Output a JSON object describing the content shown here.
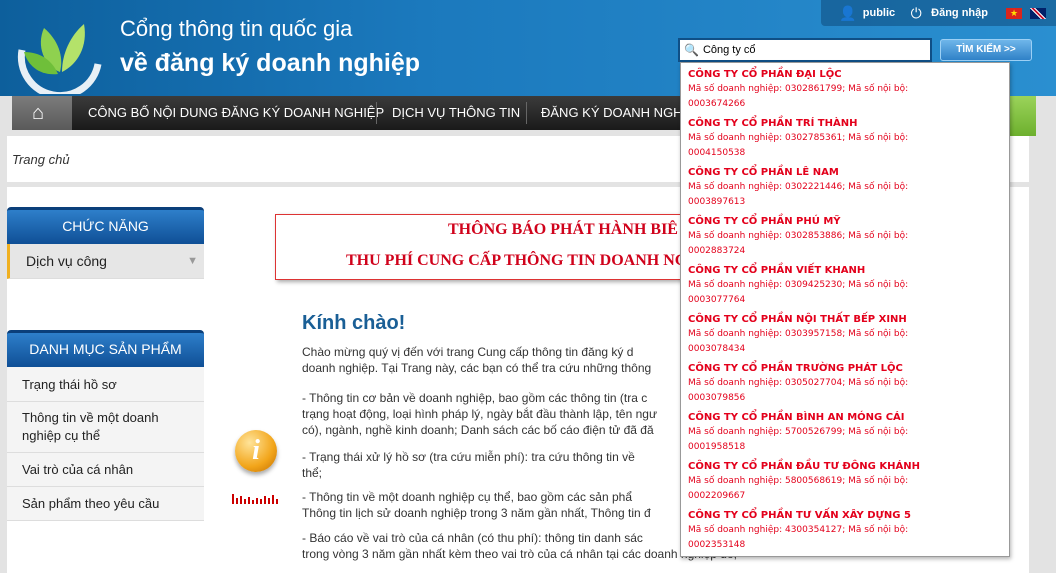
{
  "header": {
    "title_line1": "Cổng thông tin quốc gia",
    "title_line2": "về đăng ký doanh nghiệp",
    "user_label": "public",
    "login_label": "Đăng nhập",
    "search_value": "Công ty cổ",
    "search_button": "TÌM KIẾM >>"
  },
  "nav": {
    "items": [
      "CÔNG BỐ NỘI DUNG ĐĂNG KÝ DOANH NGHIỆP",
      "DỊCH VỤ THÔNG TIN",
      "ĐĂNG KÝ DOANH NGHIỆ"
    ]
  },
  "breadcrumb": "Trang chủ",
  "sidebar": {
    "functions_title": "CHỨC NĂNG",
    "functions_item": "Dịch vụ công",
    "products_title": "DANH MỤC SẢN PHẨM",
    "products": [
      "Trạng thái hồ sơ",
      "Thông tin về một doanh",
      "nghiệp cụ thể",
      "Vai trò của cá nhân",
      "Sản phẩm theo yêu cầu"
    ]
  },
  "notice": {
    "line1": "THÔNG BÁO PHÁT HÀNH BIÊ",
    "line2": "THU PHÍ CUNG CẤP THÔNG TIN DOANH NG"
  },
  "main": {
    "greeting": "Kính chào!",
    "lines": [
      "Chào mừng quý vị đến với trang Cung cấp thông tin đăng ký d",
      "doanh nghiệp. Tại Trang này, các bạn có thể tra cứu những thông",
      "- Thông tin cơ bản về doanh nghiệp, bao gồm các thông tin (tra c",
      "trạng hoạt động, loại hình pháp lý, ngày bắt đầu thành lập, tên ngư",
      "có), ngành, nghề kinh doanh; Danh sách các bố cáo điện tử đã đă",
      "- Trạng thái xử lý hồ sơ (tra cứu miễn phí): tra cứu thông tin về",
      "thể;",
      "- Thông tin về một doanh nghiệp cụ thể, bao gồm các sản phẩ",
      "Thông tin lịch sử doanh nghiệp trong 3 năm gần nhất, Thông tin đ",
      "- Báo cáo về vai trò của cá nhân (có thu phí): thông tin danh sác",
      "trong vòng 3 năm gần nhất kèm theo vai trò của cá nhân tại các doanh nghiệp đó;"
    ]
  },
  "dropdown": {
    "code_prefix": "Mã số doanh nghiệp: ",
    "internal_prefix": "; Mã số nội bộ:",
    "items": [
      {
        "name": "CÔNG TY CỔ PHẦN ĐẠI LỘC",
        "code": "0302861799",
        "internal": "0003674266"
      },
      {
        "name": "CÔNG TY CỔ PHẦN TRÍ THÀNH",
        "code": "0302785361",
        "internal": "0004150538"
      },
      {
        "name": "CÔNG TY CỔ PHẦN LÊ NAM",
        "code": "0302221446",
        "internal": "0003897613"
      },
      {
        "name": "CÔNG TY CỔ PHẦN PHÚ MỸ",
        "code": "0302853886",
        "internal": "0002883724"
      },
      {
        "name": "CÔNG TY CỔ PHẦN VIẾT KHANH",
        "code": "0309425230",
        "internal": "0003077764"
      },
      {
        "name": "CÔNG TY CỔ PHẦN NỘI THẤT BẾP XINH",
        "code": "0303957158",
        "internal": "0003078434"
      },
      {
        "name": "CÔNG TY CỔ PHẦN TRƯỜNG PHÁT LỘC",
        "code": "0305027704",
        "internal": "0003079856"
      },
      {
        "name": "CÔNG TY CỔ PHẦN BÌNH AN MÓNG CÁI",
        "code": "5700526799",
        "internal": "0001958518"
      },
      {
        "name": "CÔNG TY CỔ PHẦN ĐẦU TƯ ĐÔNG KHÁNH",
        "code": "5800568619",
        "internal": "0002209667"
      },
      {
        "name": "CÔNG TY CỔ PHẦN TƯ VẤN XÂY DỰNG 5",
        "code": "4300354127",
        "internal": "0002353148"
      }
    ]
  }
}
